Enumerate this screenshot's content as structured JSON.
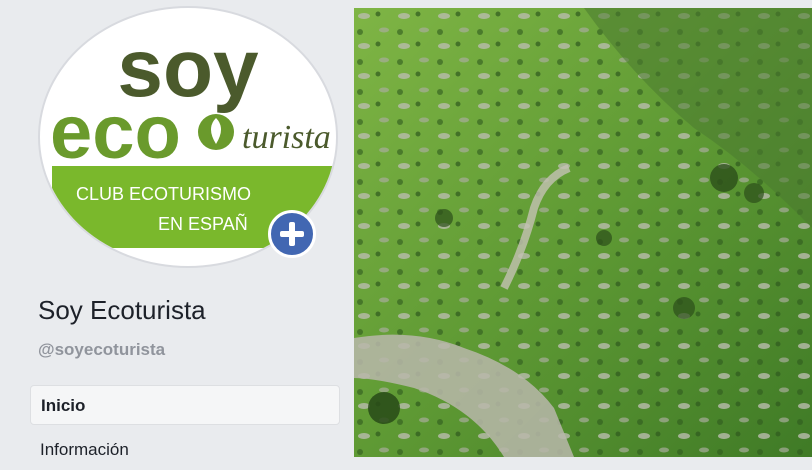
{
  "logo": {
    "word_top": "soy",
    "word_eco": "eco",
    "word_turista": "turista",
    "banner_line1": "CLUB ECOTURISMO",
    "banner_line2": "EN ESPAÑ",
    "brand_green": "#6a9a2c",
    "banner_green": "#7ab82c",
    "dark_olive": "#4b5a2c"
  },
  "add_button": {
    "icon": "plus-icon",
    "color": "#4267b2"
  },
  "page": {
    "name": "Soy Ecoturista",
    "handle": "@soyecoturista"
  },
  "nav": {
    "items": [
      {
        "label": "Inicio",
        "active": true
      },
      {
        "label": "Información",
        "active": false
      }
    ]
  },
  "colors": {
    "background": "#e9ebee",
    "text": "#1d2129",
    "muted_text": "#90949c"
  }
}
